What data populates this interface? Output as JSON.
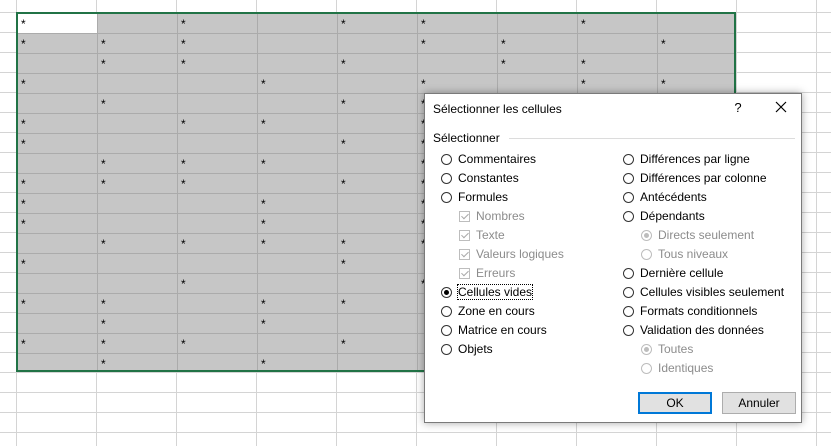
{
  "sheet": {
    "grid_color": "#d4d4d4",
    "selection_color": "#c6c6c6",
    "selection_border": "#217346",
    "asterisk": "*"
  },
  "dialog": {
    "title": "Sélectionner les cellules",
    "help_icon": "?",
    "close_icon": "close-icon",
    "group_label": "Sélectionner",
    "left_options": [
      {
        "label": "Commentaires",
        "kind": "radio",
        "checked": false,
        "enabled": true
      },
      {
        "label": "Constantes",
        "kind": "radio",
        "checked": false,
        "enabled": true
      },
      {
        "label": "Formules",
        "kind": "radio",
        "checked": false,
        "enabled": true
      },
      {
        "label": "Nombres",
        "kind": "checkbox",
        "checked": true,
        "enabled": false
      },
      {
        "label": "Texte",
        "kind": "checkbox",
        "checked": true,
        "enabled": false
      },
      {
        "label": "Valeurs logiques",
        "kind": "checkbox",
        "checked": true,
        "enabled": false
      },
      {
        "label": "Erreurs",
        "kind": "checkbox",
        "checked": true,
        "enabled": false
      },
      {
        "label": "Cellules vides",
        "kind": "radio",
        "checked": true,
        "enabled": true
      },
      {
        "label": "Zone en cours",
        "kind": "radio",
        "checked": false,
        "enabled": true
      },
      {
        "label": "Matrice en cours",
        "kind": "radio",
        "checked": false,
        "enabled": true
      },
      {
        "label": "Objets",
        "kind": "radio",
        "checked": false,
        "enabled": true
      }
    ],
    "right_options": [
      {
        "label": "Différences par ligne",
        "kind": "radio",
        "checked": false,
        "enabled": true
      },
      {
        "label": "Différences par colonne",
        "kind": "radio",
        "checked": false,
        "enabled": true
      },
      {
        "label": "Antécédents",
        "kind": "radio",
        "checked": false,
        "enabled": true
      },
      {
        "label": "Dépendants",
        "kind": "radio",
        "checked": false,
        "enabled": true
      },
      {
        "label": "Directs seulement",
        "kind": "radio",
        "checked": true,
        "enabled": false
      },
      {
        "label": "Tous niveaux",
        "kind": "radio",
        "checked": false,
        "enabled": false
      },
      {
        "label": "Dernière cellule",
        "kind": "radio",
        "checked": false,
        "enabled": true
      },
      {
        "label": "Cellules visibles seulement",
        "kind": "radio",
        "checked": false,
        "enabled": true
      },
      {
        "label": "Formats conditionnels",
        "kind": "radio",
        "checked": false,
        "enabled": true
      },
      {
        "label": "Validation des données",
        "kind": "radio",
        "checked": false,
        "enabled": true
      },
      {
        "label": "Toutes",
        "kind": "radio",
        "checked": true,
        "enabled": false
      },
      {
        "label": "Identiques",
        "kind": "radio",
        "checked": false,
        "enabled": false
      }
    ],
    "ok_label": "OK",
    "cancel_label": "Annuler"
  }
}
